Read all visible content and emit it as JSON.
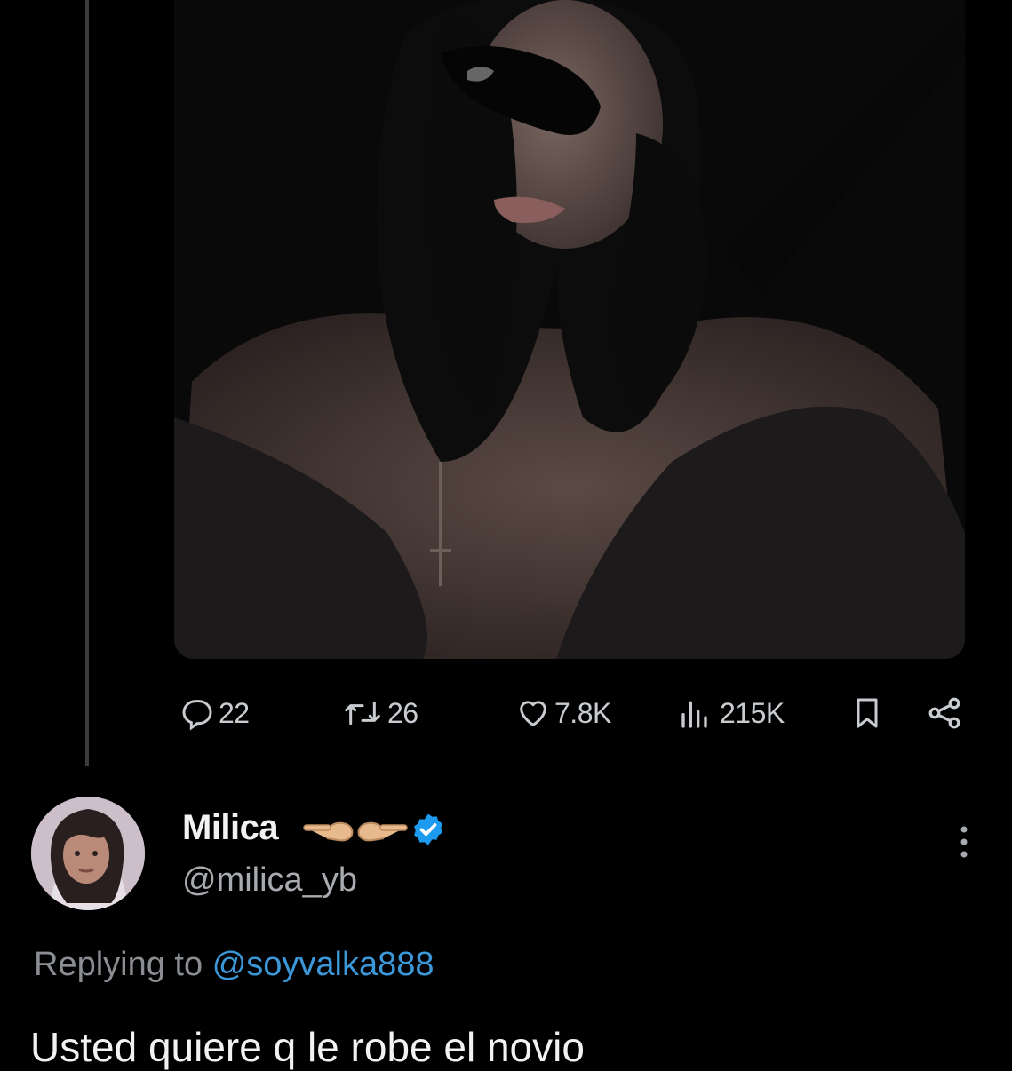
{
  "parent_tweet": {
    "media_description": "photo",
    "actions": {
      "replies": "22",
      "retweets": "26",
      "likes": "7.8K",
      "views": "215K"
    }
  },
  "reply": {
    "display_name": "Milica",
    "emoji": "👉🏼👈🏼",
    "handle": "@milica_yb",
    "replying_label": "Replying to",
    "replying_to": "@soyvalka888",
    "text": "Usted quiere q le robe el novio"
  },
  "colors": {
    "background": "#000000",
    "verified": "#1d9bf0",
    "mention": "#3b97d8",
    "muted_text": "#8a8e92"
  },
  "icons": [
    "reply-icon",
    "retweet-icon",
    "like-icon",
    "views-icon",
    "bookmark-icon",
    "share-icon",
    "verified-badge-icon",
    "more-options-icon"
  ]
}
